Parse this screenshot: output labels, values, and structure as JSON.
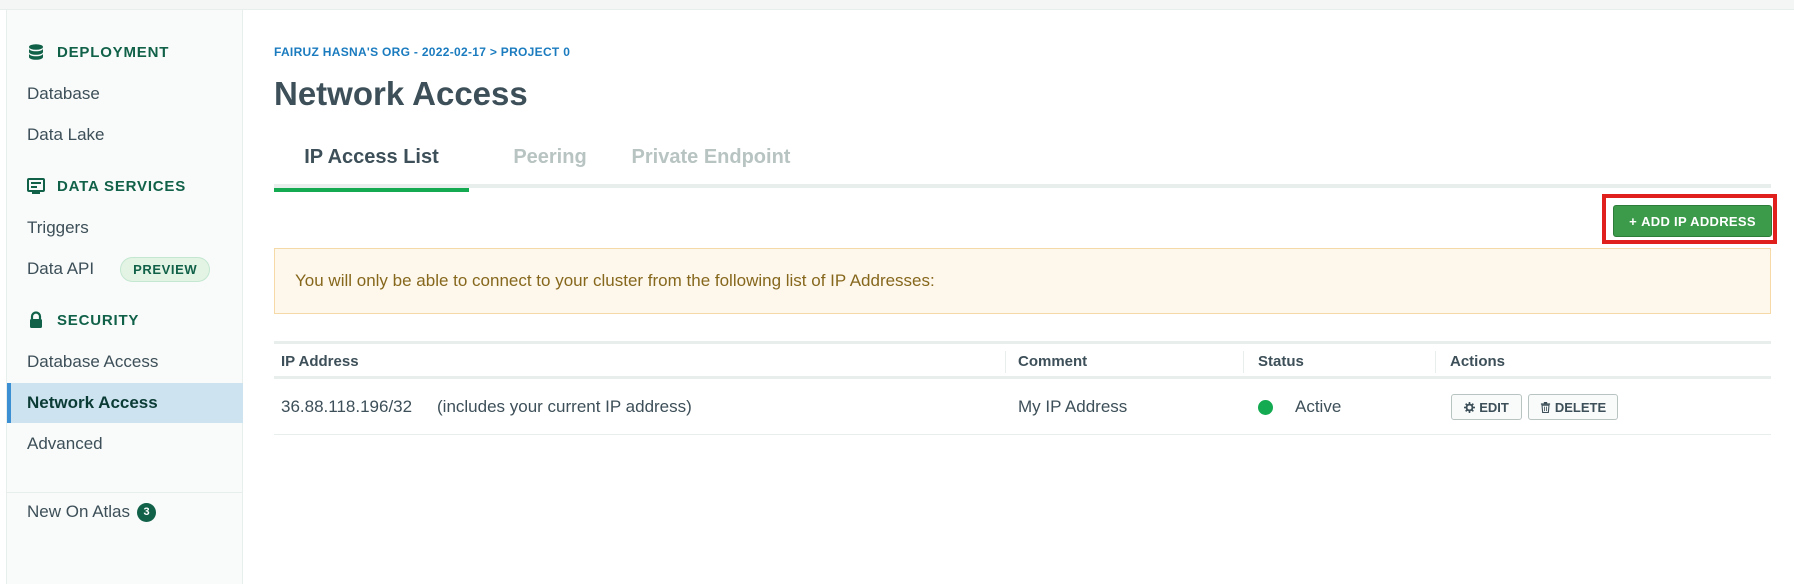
{
  "sidebar": {
    "sections": [
      {
        "title": "DEPLOYMENT",
        "icon": "database-icon",
        "items": [
          "Database",
          "Data Lake"
        ]
      },
      {
        "title": "DATA SERVICES",
        "icon": "terminal-icon",
        "items": [
          "Triggers",
          "Data API"
        ]
      },
      {
        "title": "SECURITY",
        "icon": "lock-icon",
        "items": [
          "Database Access",
          "Network Access",
          "Advanced"
        ]
      }
    ],
    "preview_badge": "PREVIEW",
    "active_item": "Network Access",
    "new_on_atlas": {
      "label": "New On Atlas",
      "count": "3"
    }
  },
  "header": {
    "breadcrumb": "FAIRUZ HASNA'S ORG - 2022-02-17 > PROJECT 0",
    "title": "Network Access"
  },
  "tabs": [
    {
      "label": "IP Access List",
      "active": true
    },
    {
      "label": "Peering",
      "active": false
    },
    {
      "label": "Private Endpoint",
      "active": false
    }
  ],
  "add_button": {
    "label": "ADD IP ADDRESS",
    "icon": "plus-icon"
  },
  "info_banner": {
    "text": "You will only be able to connect to your cluster from the following list of IP Addresses:"
  },
  "table": {
    "headers": [
      "IP Address",
      "Comment",
      "Status",
      "Actions"
    ],
    "rows": [
      {
        "ip": "36.88.118.196/32",
        "note": "(includes your current IP address)",
        "comment": "My IP Address",
        "status": "Active",
        "actions": [
          {
            "label": "EDIT",
            "icon": "gear-icon"
          },
          {
            "label": "DELETE",
            "icon": "trash-icon"
          }
        ]
      }
    ]
  },
  "colors": {
    "accent_green": "#13aa52",
    "button_green": "#3c9b4a",
    "link_blue": "#1a7bbf",
    "highlight_red": "#e0201d"
  }
}
